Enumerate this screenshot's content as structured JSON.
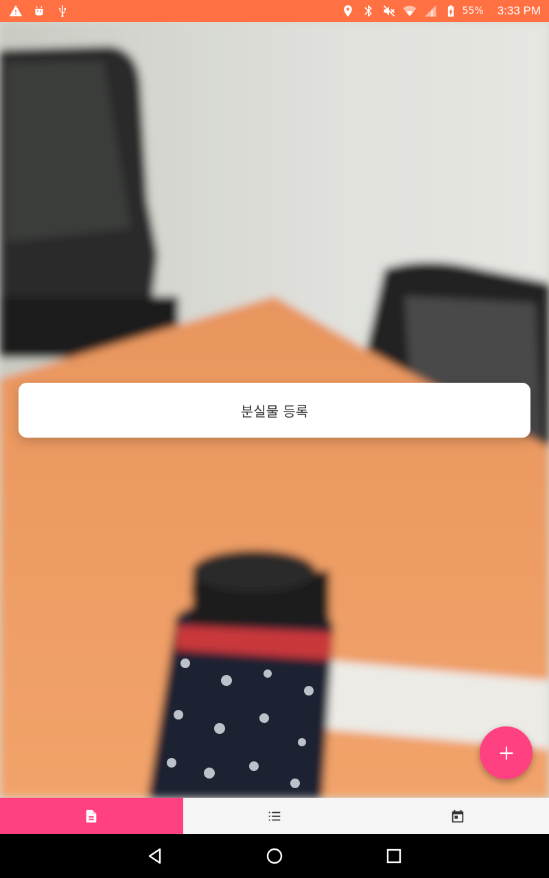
{
  "status_bar": {
    "left_icons": [
      "warning-icon",
      "android-icon",
      "usb-icon"
    ],
    "right_icons": [
      "location-icon",
      "bluetooth-icon",
      "mute-icon",
      "wifi-icon",
      "signal-icon",
      "battery-icon"
    ],
    "battery": "55%",
    "time": "3:33 PM",
    "color": "#ff7043"
  },
  "card": {
    "label": "분실물 등록"
  },
  "fab": {
    "icon": "plus-icon",
    "color": "#ff4081"
  },
  "bottom_tabs": [
    {
      "icon": "document-icon",
      "active": true
    },
    {
      "icon": "list-icon",
      "active": false
    },
    {
      "icon": "calendar-icon",
      "active": false
    }
  ],
  "nav_bar": [
    "back-icon",
    "home-icon",
    "recents-icon"
  ],
  "accent_color": "#ff4081"
}
